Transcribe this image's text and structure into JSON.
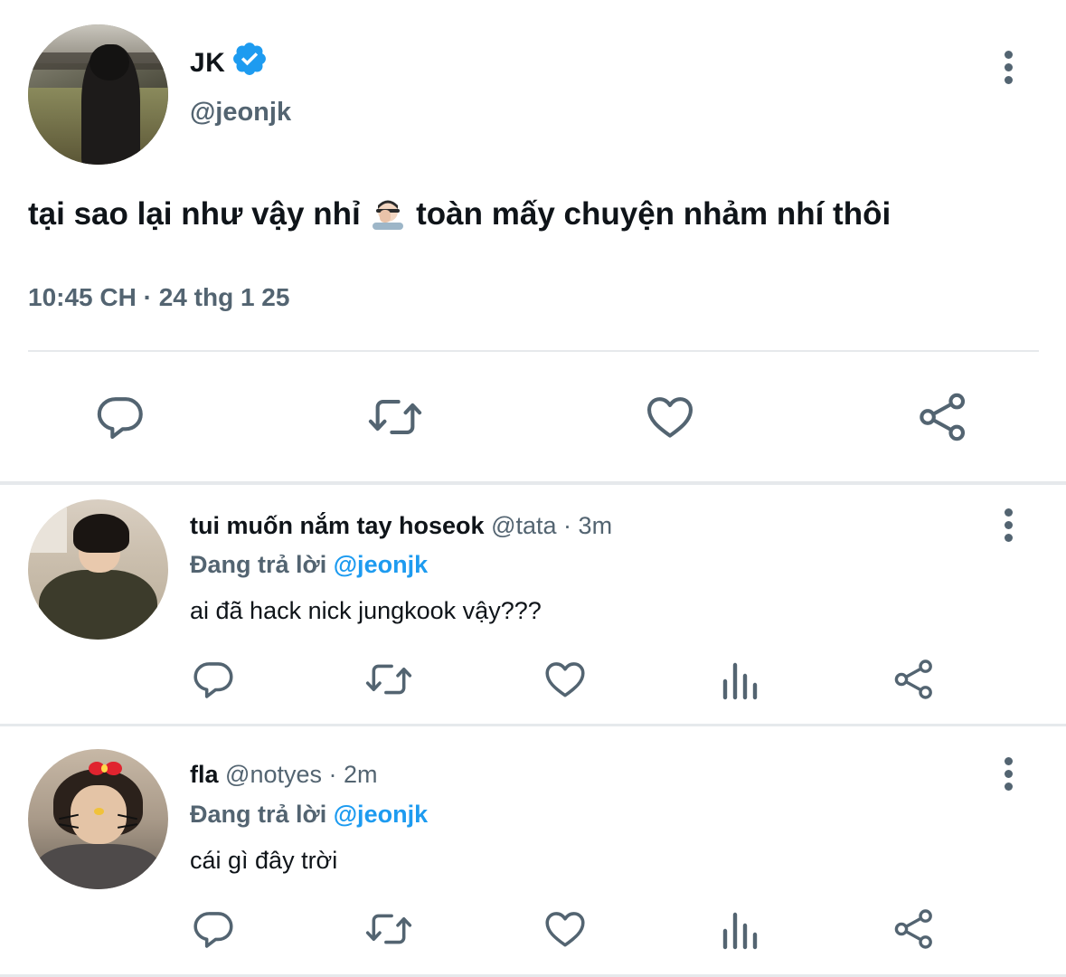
{
  "main_tweet": {
    "author_name": "JK",
    "handle": "@jeonjk",
    "text_before_emoji": "tại sao lại như vậy nhỉ",
    "text_after_emoji": "toàn mấy chuyện nhảm nhí thôi",
    "timestamp": "10:45 CH · 24 thg 1 25",
    "icons": [
      "reply-icon",
      "retweet-icon",
      "like-icon",
      "share-icon"
    ]
  },
  "replies": [
    {
      "name": "tui muốn nắm tay hoseok",
      "handle": "@tata",
      "time": "3m",
      "replying_label": "Đang trả lời",
      "replying_to": "@jeonjk",
      "text": "ai đã hack nick jungkook vậy???"
    },
    {
      "name": "fla",
      "handle": "@notyes",
      "time": "2m",
      "replying_label": "Đang trả lời",
      "replying_to": "@jeonjk",
      "text": "cái gì đây trời"
    }
  ],
  "colors": {
    "accent": "#1d9bf0",
    "secondary_text": "#536471",
    "icon": "#536471",
    "divider": "#e6e9ec"
  }
}
